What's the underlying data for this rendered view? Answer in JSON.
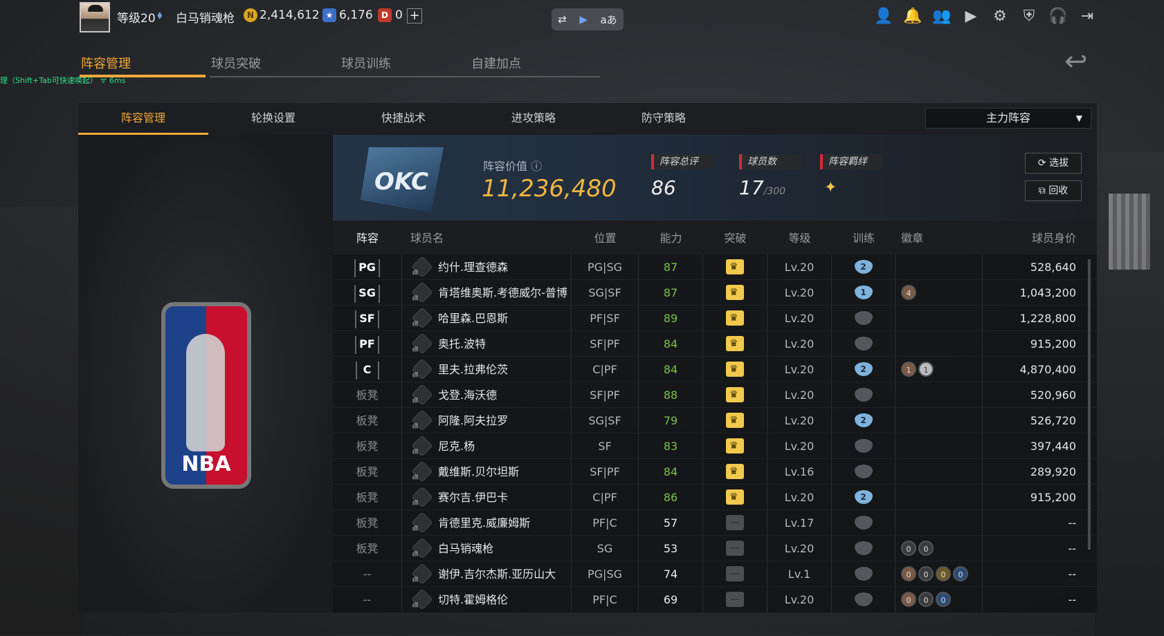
{
  "topbar": {
    "level": "等级20",
    "username": "白马销魂枪",
    "coins": "2,414,612",
    "stars": "6,176",
    "tickets": "0",
    "plus": "+",
    "tool_icons": [
      "switch-icon",
      "video-icon",
      "translate-icon"
    ],
    "tool_glyphs": [
      "⇄",
      "▶",
      "aあ"
    ],
    "right_icons": [
      "profile-icon",
      "bell-icon",
      "friends-icon",
      "play-icon",
      "gear-icon",
      "shield-icon",
      "headset-icon",
      "exit-icon"
    ],
    "right_glyphs": [
      "👤",
      "🔔",
      "👥",
      "▶",
      "⚙",
      "⛨",
      "🎧",
      "⇥"
    ]
  },
  "main_tabs": [
    "阵容管理",
    "球员突破",
    "球员训练",
    "自建加点"
  ],
  "hint": "理（Shift+Tab可快速唤起）  ᯤ 6ms",
  "sub_tabs": [
    "阵容管理",
    "轮换设置",
    "快捷战术",
    "进攻策略",
    "防守策略"
  ],
  "lineup_select": "主力阵容",
  "info": {
    "team_logo": "OKC",
    "value_label": "阵容价值 ⓘ",
    "value": "11,236,480",
    "total_rating_label": "阵容总评",
    "total_rating": "86",
    "player_count_label": "球员数",
    "player_count": "17",
    "player_max": "/300",
    "bond_label": "阵容羁绊",
    "btn_select": "⟳ 选拔",
    "btn_recycle": "⧉ 回收"
  },
  "table": {
    "headers": [
      "阵容",
      "球员名",
      "位置",
      "能力",
      "突破",
      "等级",
      "训练",
      "徽章",
      "球员身价"
    ],
    "rows": [
      {
        "slot": "PG",
        "name": "约什.理查德森",
        "pos": "PG|SG",
        "ability": "87",
        "break": true,
        "level": "Lv.20",
        "train": "2",
        "badges": [],
        "value": "528,640"
      },
      {
        "slot": "SG",
        "name": "肯塔维奥斯.考德威尔-普博",
        "pos": "SG|SF",
        "ability": "87",
        "break": true,
        "level": "Lv.20",
        "train": "1",
        "badges": [
          {
            "t": "b",
            "v": "4"
          }
        ],
        "value": "1,043,200"
      },
      {
        "slot": "SF",
        "name": "哈里森.巴恩斯",
        "pos": "PF|SF",
        "ability": "89",
        "break": true,
        "level": "Lv.20",
        "train": "",
        "badges": [],
        "value": "1,228,800"
      },
      {
        "slot": "PF",
        "name": "奥托.波特",
        "pos": "SF|PF",
        "ability": "84",
        "break": true,
        "level": "Lv.20",
        "train": "",
        "badges": [],
        "value": "915,200"
      },
      {
        "slot": "C",
        "name": "里夫.拉弗伦茨",
        "pos": "C|PF",
        "ability": "84",
        "break": true,
        "level": "Lv.20",
        "train": "2",
        "badges": [
          {
            "t": "b",
            "v": "1"
          },
          {
            "t": "s",
            "v": "1"
          }
        ],
        "value": "4,870,400"
      },
      {
        "slot": "板凳",
        "name": "戈登.海沃德",
        "pos": "SF|PF",
        "ability": "88",
        "break": true,
        "level": "Lv.20",
        "train": "",
        "badges": [],
        "value": "520,960"
      },
      {
        "slot": "板凳",
        "name": "阿隆.阿夫拉罗",
        "pos": "SG|SF",
        "ability": "79",
        "break": true,
        "level": "Lv.20",
        "train": "2",
        "badges": [],
        "value": "526,720"
      },
      {
        "slot": "板凳",
        "name": "尼克.杨",
        "pos": "SF",
        "ability": "83",
        "break": true,
        "level": "Lv.20",
        "train": "",
        "badges": [],
        "value": "397,440"
      },
      {
        "slot": "板凳",
        "name": "戴维斯.贝尔坦斯",
        "pos": "SF|PF",
        "ability": "84",
        "break": true,
        "level": "Lv.16",
        "train": "",
        "badges": [],
        "value": "289,920"
      },
      {
        "slot": "板凳",
        "name": "赛尔吉.伊巴卡",
        "pos": "C|PF",
        "ability": "86",
        "break": true,
        "level": "Lv.20",
        "train": "2",
        "badges": [],
        "value": "915,200"
      },
      {
        "slot": "板凳",
        "name": "肯德里克.威廉姆斯",
        "pos": "PF|C",
        "ability": "57",
        "break": false,
        "level": "Lv.17",
        "train": "",
        "badges": [],
        "value": "--"
      },
      {
        "slot": "板凳",
        "name": "白马销魂枪",
        "pos": "SG",
        "ability": "53",
        "break": false,
        "level": "Lv.20",
        "train": "",
        "badges": [
          {
            "t": "n",
            "v": "0"
          },
          {
            "t": "n",
            "v": "0"
          }
        ],
        "value": "--"
      },
      {
        "slot": "--",
        "name": "谢伊.吉尔杰斯.亚历山大",
        "pos": "PG|SG",
        "ability": "74",
        "break": false,
        "level": "Lv.1",
        "train": "",
        "badges": [
          {
            "t": "b",
            "v": "0"
          },
          {
            "t": "n",
            "v": "0"
          },
          {
            "t": "g",
            "v": "0"
          },
          {
            "t": "u",
            "v": "0"
          }
        ],
        "value": "--"
      },
      {
        "slot": "--",
        "name": "切特.霍姆格伦",
        "pos": "PF|C",
        "ability": "69",
        "break": false,
        "level": "Lv.20",
        "train": "",
        "badges": [
          {
            "t": "b",
            "v": "0"
          },
          {
            "t": "n",
            "v": "0"
          },
          {
            "t": "u",
            "v": "0"
          }
        ],
        "value": "--"
      }
    ]
  },
  "colors": {
    "accent": "#f2a93b",
    "ability_green": "#7cc44a",
    "value_gold": "#f2b640"
  }
}
